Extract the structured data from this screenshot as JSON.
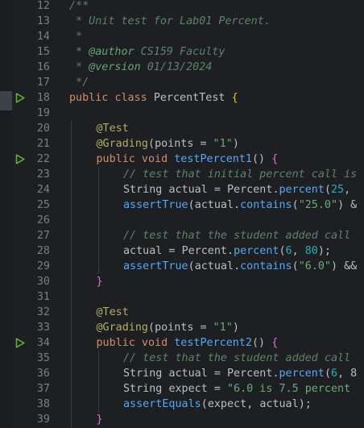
{
  "editor": {
    "run_icon_color": "#5fb832",
    "lines": [
      {
        "n": "12",
        "run": false,
        "indent": 0,
        "tokens": [
          {
            "t": "/**",
            "c": "doc"
          }
        ]
      },
      {
        "n": "13",
        "run": false,
        "indent": 0,
        "tokens": [
          {
            "t": " * Unit test for Lab01 Percent.",
            "c": "doc"
          }
        ]
      },
      {
        "n": "14",
        "run": false,
        "indent": 0,
        "tokens": [
          {
            "t": " *",
            "c": "doc"
          }
        ]
      },
      {
        "n": "15",
        "run": false,
        "indent": 0,
        "tokens": [
          {
            "t": " * ",
            "c": "doc"
          },
          {
            "t": "@author",
            "c": "tag"
          },
          {
            "t": " CS159 Faculty",
            "c": "doc"
          }
        ]
      },
      {
        "n": "16",
        "run": false,
        "indent": 0,
        "tokens": [
          {
            "t": " * ",
            "c": "doc"
          },
          {
            "t": "@version",
            "c": "tag"
          },
          {
            "t": " 01/13/2024",
            "c": "doc"
          }
        ]
      },
      {
        "n": "17",
        "run": false,
        "indent": 0,
        "tokens": [
          {
            "t": " */",
            "c": "doc"
          }
        ]
      },
      {
        "n": "18",
        "run": true,
        "indent": 0,
        "tokens": [
          {
            "t": "public class ",
            "c": "kw"
          },
          {
            "t": "PercentTest ",
            "c": "cls"
          },
          {
            "t": "{",
            "c": "brace"
          }
        ]
      },
      {
        "n": "19",
        "run": false,
        "indent": 0,
        "tokens": []
      },
      {
        "n": "20",
        "run": false,
        "indent": 1,
        "tokens": [
          {
            "t": "@Test",
            "c": "ann"
          }
        ]
      },
      {
        "n": "21",
        "run": false,
        "indent": 1,
        "tokens": [
          {
            "t": "@Grading",
            "c": "ann"
          },
          {
            "t": "(",
            "c": "punc"
          },
          {
            "t": "points",
            "c": "var"
          },
          {
            "t": " = ",
            "c": "punc"
          },
          {
            "t": "\"1\"",
            "c": "str"
          },
          {
            "t": ")",
            "c": "punc"
          }
        ]
      },
      {
        "n": "22",
        "run": true,
        "indent": 1,
        "tokens": [
          {
            "t": "public void ",
            "c": "kw"
          },
          {
            "t": "testPercent1",
            "c": "fn"
          },
          {
            "t": "() ",
            "c": "punc"
          },
          {
            "t": "{",
            "c": "bracep"
          }
        ]
      },
      {
        "n": "23",
        "run": false,
        "indent": 2,
        "tokens": [
          {
            "t": "// test that initial percent call is",
            "c": "comment"
          }
        ]
      },
      {
        "n": "24",
        "run": false,
        "indent": 2,
        "tokens": [
          {
            "t": "String ",
            "c": "cls"
          },
          {
            "t": "actual",
            "c": "var"
          },
          {
            "t": " = ",
            "c": "punc"
          },
          {
            "t": "Percent",
            "c": "cls"
          },
          {
            "t": ".",
            "c": "punc"
          },
          {
            "t": "percent",
            "c": "fn"
          },
          {
            "t": "(",
            "c": "punc"
          },
          {
            "t": "25",
            "c": "num"
          },
          {
            "t": ",",
            "c": "punc"
          }
        ]
      },
      {
        "n": "25",
        "run": false,
        "indent": 2,
        "tokens": [
          {
            "t": "assertTrue",
            "c": "fn"
          },
          {
            "t": "(",
            "c": "punc"
          },
          {
            "t": "actual",
            "c": "var"
          },
          {
            "t": ".",
            "c": "punc"
          },
          {
            "t": "contains",
            "c": "fn"
          },
          {
            "t": "(",
            "c": "punc"
          },
          {
            "t": "\"25.0\"",
            "c": "str"
          },
          {
            "t": ") &",
            "c": "punc"
          }
        ]
      },
      {
        "n": "26",
        "run": false,
        "indent": 2,
        "tokens": []
      },
      {
        "n": "27",
        "run": false,
        "indent": 2,
        "tokens": [
          {
            "t": "// test that the student added call",
            "c": "comment"
          }
        ]
      },
      {
        "n": "28",
        "run": false,
        "indent": 2,
        "tokens": [
          {
            "t": "actual",
            "c": "var"
          },
          {
            "t": " = ",
            "c": "punc"
          },
          {
            "t": "Percent",
            "c": "cls"
          },
          {
            "t": ".",
            "c": "punc"
          },
          {
            "t": "percent",
            "c": "fn"
          },
          {
            "t": "(",
            "c": "punc"
          },
          {
            "t": "6",
            "c": "num"
          },
          {
            "t": ", ",
            "c": "punc"
          },
          {
            "t": "80",
            "c": "num"
          },
          {
            "t": ");",
            "c": "punc"
          }
        ]
      },
      {
        "n": "29",
        "run": false,
        "indent": 2,
        "tokens": [
          {
            "t": "assertTrue",
            "c": "fn"
          },
          {
            "t": "(",
            "c": "punc"
          },
          {
            "t": "actual",
            "c": "var"
          },
          {
            "t": ".",
            "c": "punc"
          },
          {
            "t": "contains",
            "c": "fn"
          },
          {
            "t": "(",
            "c": "punc"
          },
          {
            "t": "\"6.0\"",
            "c": "str"
          },
          {
            "t": ") &&",
            "c": "punc"
          }
        ]
      },
      {
        "n": "30",
        "run": false,
        "indent": 1,
        "tokens": [
          {
            "t": "}",
            "c": "bracep"
          }
        ]
      },
      {
        "n": "31",
        "run": false,
        "indent": 1,
        "tokens": []
      },
      {
        "n": "32",
        "run": false,
        "indent": 1,
        "tokens": [
          {
            "t": "@Test",
            "c": "ann"
          }
        ]
      },
      {
        "n": "33",
        "run": false,
        "indent": 1,
        "tokens": [
          {
            "t": "@Grading",
            "c": "ann"
          },
          {
            "t": "(",
            "c": "punc"
          },
          {
            "t": "points",
            "c": "var"
          },
          {
            "t": " = ",
            "c": "punc"
          },
          {
            "t": "\"1\"",
            "c": "str"
          },
          {
            "t": ")",
            "c": "punc"
          }
        ]
      },
      {
        "n": "34",
        "run": true,
        "indent": 1,
        "tokens": [
          {
            "t": "public void ",
            "c": "kw"
          },
          {
            "t": "testPercent2",
            "c": "fn"
          },
          {
            "t": "() ",
            "c": "punc"
          },
          {
            "t": "{",
            "c": "bracep"
          }
        ]
      },
      {
        "n": "35",
        "run": false,
        "indent": 2,
        "tokens": [
          {
            "t": "// test that the student added call",
            "c": "comment"
          }
        ]
      },
      {
        "n": "36",
        "run": false,
        "indent": 2,
        "tokens": [
          {
            "t": "String ",
            "c": "cls"
          },
          {
            "t": "actual",
            "c": "var"
          },
          {
            "t": " = ",
            "c": "punc"
          },
          {
            "t": "Percent",
            "c": "cls"
          },
          {
            "t": ".",
            "c": "punc"
          },
          {
            "t": "percent",
            "c": "fn"
          },
          {
            "t": "(",
            "c": "punc"
          },
          {
            "t": "6",
            "c": "num"
          },
          {
            "t": ", 8",
            "c": "punc"
          }
        ]
      },
      {
        "n": "37",
        "run": false,
        "indent": 2,
        "tokens": [
          {
            "t": "String ",
            "c": "cls"
          },
          {
            "t": "expect",
            "c": "var"
          },
          {
            "t": " = ",
            "c": "punc"
          },
          {
            "t": "\"6.0 is 7.5 percent",
            "c": "str"
          }
        ]
      },
      {
        "n": "38",
        "run": false,
        "indent": 2,
        "tokens": [
          {
            "t": "assertEquals",
            "c": "fn"
          },
          {
            "t": "(",
            "c": "punc"
          },
          {
            "t": "expect",
            "c": "var"
          },
          {
            "t": ", ",
            "c": "punc"
          },
          {
            "t": "actual",
            "c": "var"
          },
          {
            "t": ");",
            "c": "punc"
          }
        ]
      },
      {
        "n": "39",
        "run": false,
        "indent": 1,
        "tokens": [
          {
            "t": "}",
            "c": "bracep"
          }
        ]
      }
    ]
  }
}
